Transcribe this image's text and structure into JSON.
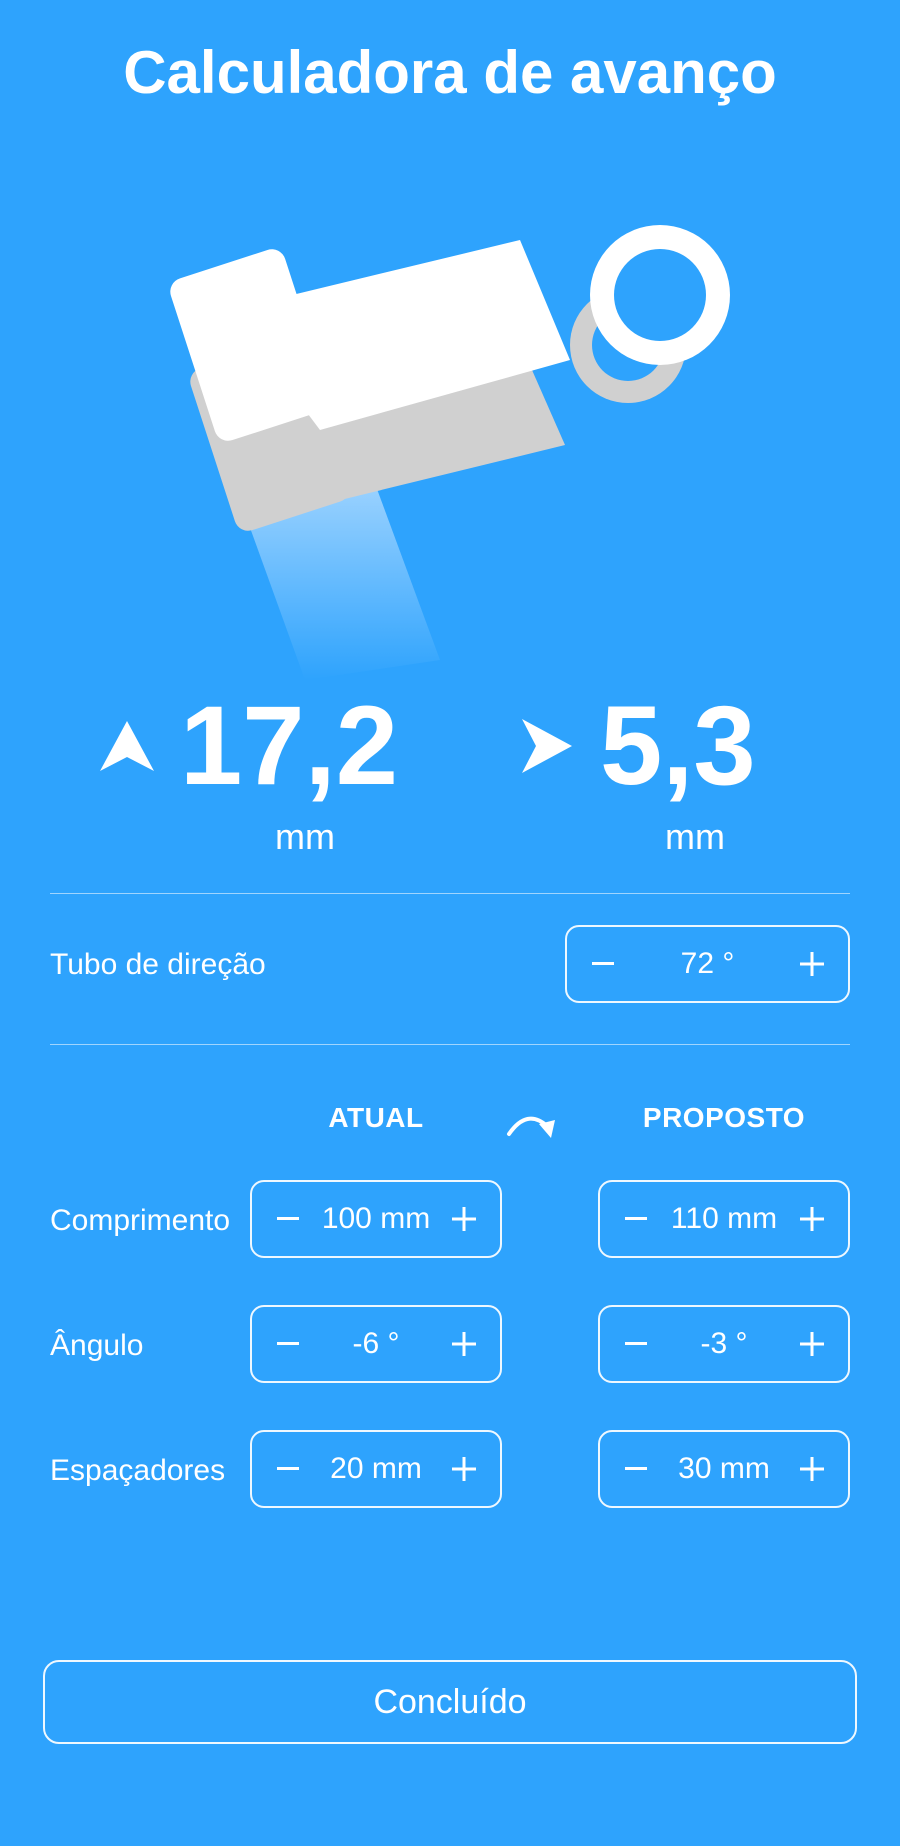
{
  "title": "Calculadora de avanço",
  "results": {
    "stack": {
      "value": "17,2",
      "unit": "mm",
      "icon": "arrow-up-icon"
    },
    "reach": {
      "value": "5,3",
      "unit": "mm",
      "icon": "arrow-right-icon"
    }
  },
  "head_tube": {
    "label": "Tubo de direção",
    "value": "72 °"
  },
  "columns": {
    "current": "ATUAL",
    "proposed": "PROPOSTO",
    "icon": "rotate-arrow-icon"
  },
  "rows": [
    {
      "label": "Comprimento",
      "current": "100 mm",
      "proposed": "110 mm"
    },
    {
      "label": "Ângulo",
      "current": "-6 °",
      "proposed": "-3 °"
    },
    {
      "label": "Espaçadores",
      "current": "20 mm",
      "proposed": "30 mm"
    }
  ],
  "done_label": "Concluído",
  "colors": {
    "background": "#2ea3fd",
    "foreground": "#ffffff",
    "stem_shadow": "#d0d0d0"
  }
}
